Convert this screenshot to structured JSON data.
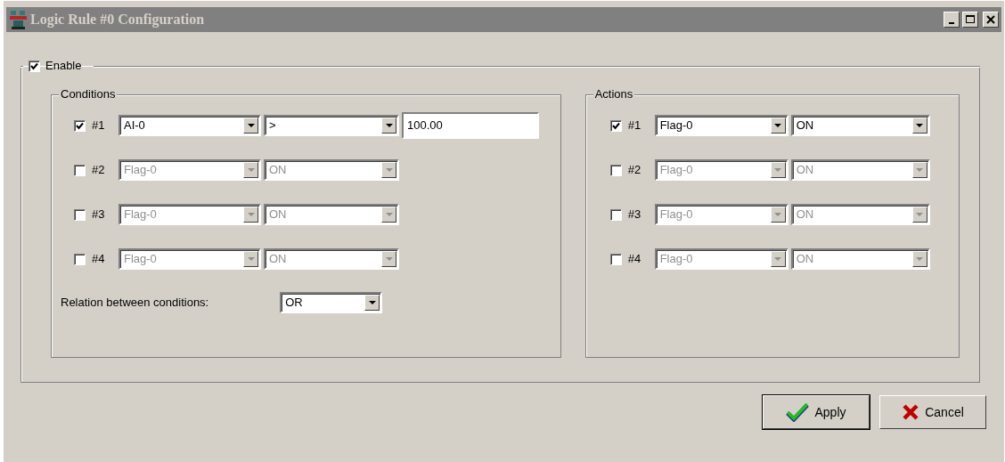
{
  "window": {
    "title": "Logic Rule #0 Configuration"
  },
  "enable": {
    "label": "Enable",
    "checked": true
  },
  "conditions": {
    "title": "Conditions",
    "rows": [
      {
        "label": "#1",
        "checked": true,
        "disabled": false,
        "source": "AI-0",
        "operator": ">",
        "value": "100.00"
      },
      {
        "label": "#2",
        "checked": false,
        "disabled": true,
        "source": "Flag-0",
        "operator": "ON"
      },
      {
        "label": "#3",
        "checked": false,
        "disabled": true,
        "source": "Flag-0",
        "operator": "ON"
      },
      {
        "label": "#4",
        "checked": false,
        "disabled": true,
        "source": "Flag-0",
        "operator": "ON"
      }
    ],
    "relation": {
      "label": "Relation between conditions:",
      "value": "OR"
    }
  },
  "actions": {
    "title": "Actions",
    "rows": [
      {
        "label": "#1",
        "checked": true,
        "disabled": false,
        "target": "Flag-0",
        "state": "ON"
      },
      {
        "label": "#2",
        "checked": false,
        "disabled": true,
        "target": "Flag-0",
        "state": "ON"
      },
      {
        "label": "#3",
        "checked": false,
        "disabled": true,
        "target": "Flag-0",
        "state": "ON"
      },
      {
        "label": "#4",
        "checked": false,
        "disabled": true,
        "target": "Flag-0",
        "state": "ON"
      }
    ]
  },
  "buttons": [
    {
      "label": "Apply",
      "kind": "apply",
      "default": true
    },
    {
      "label": "Cancel",
      "kind": "cancel",
      "default": false
    }
  ]
}
